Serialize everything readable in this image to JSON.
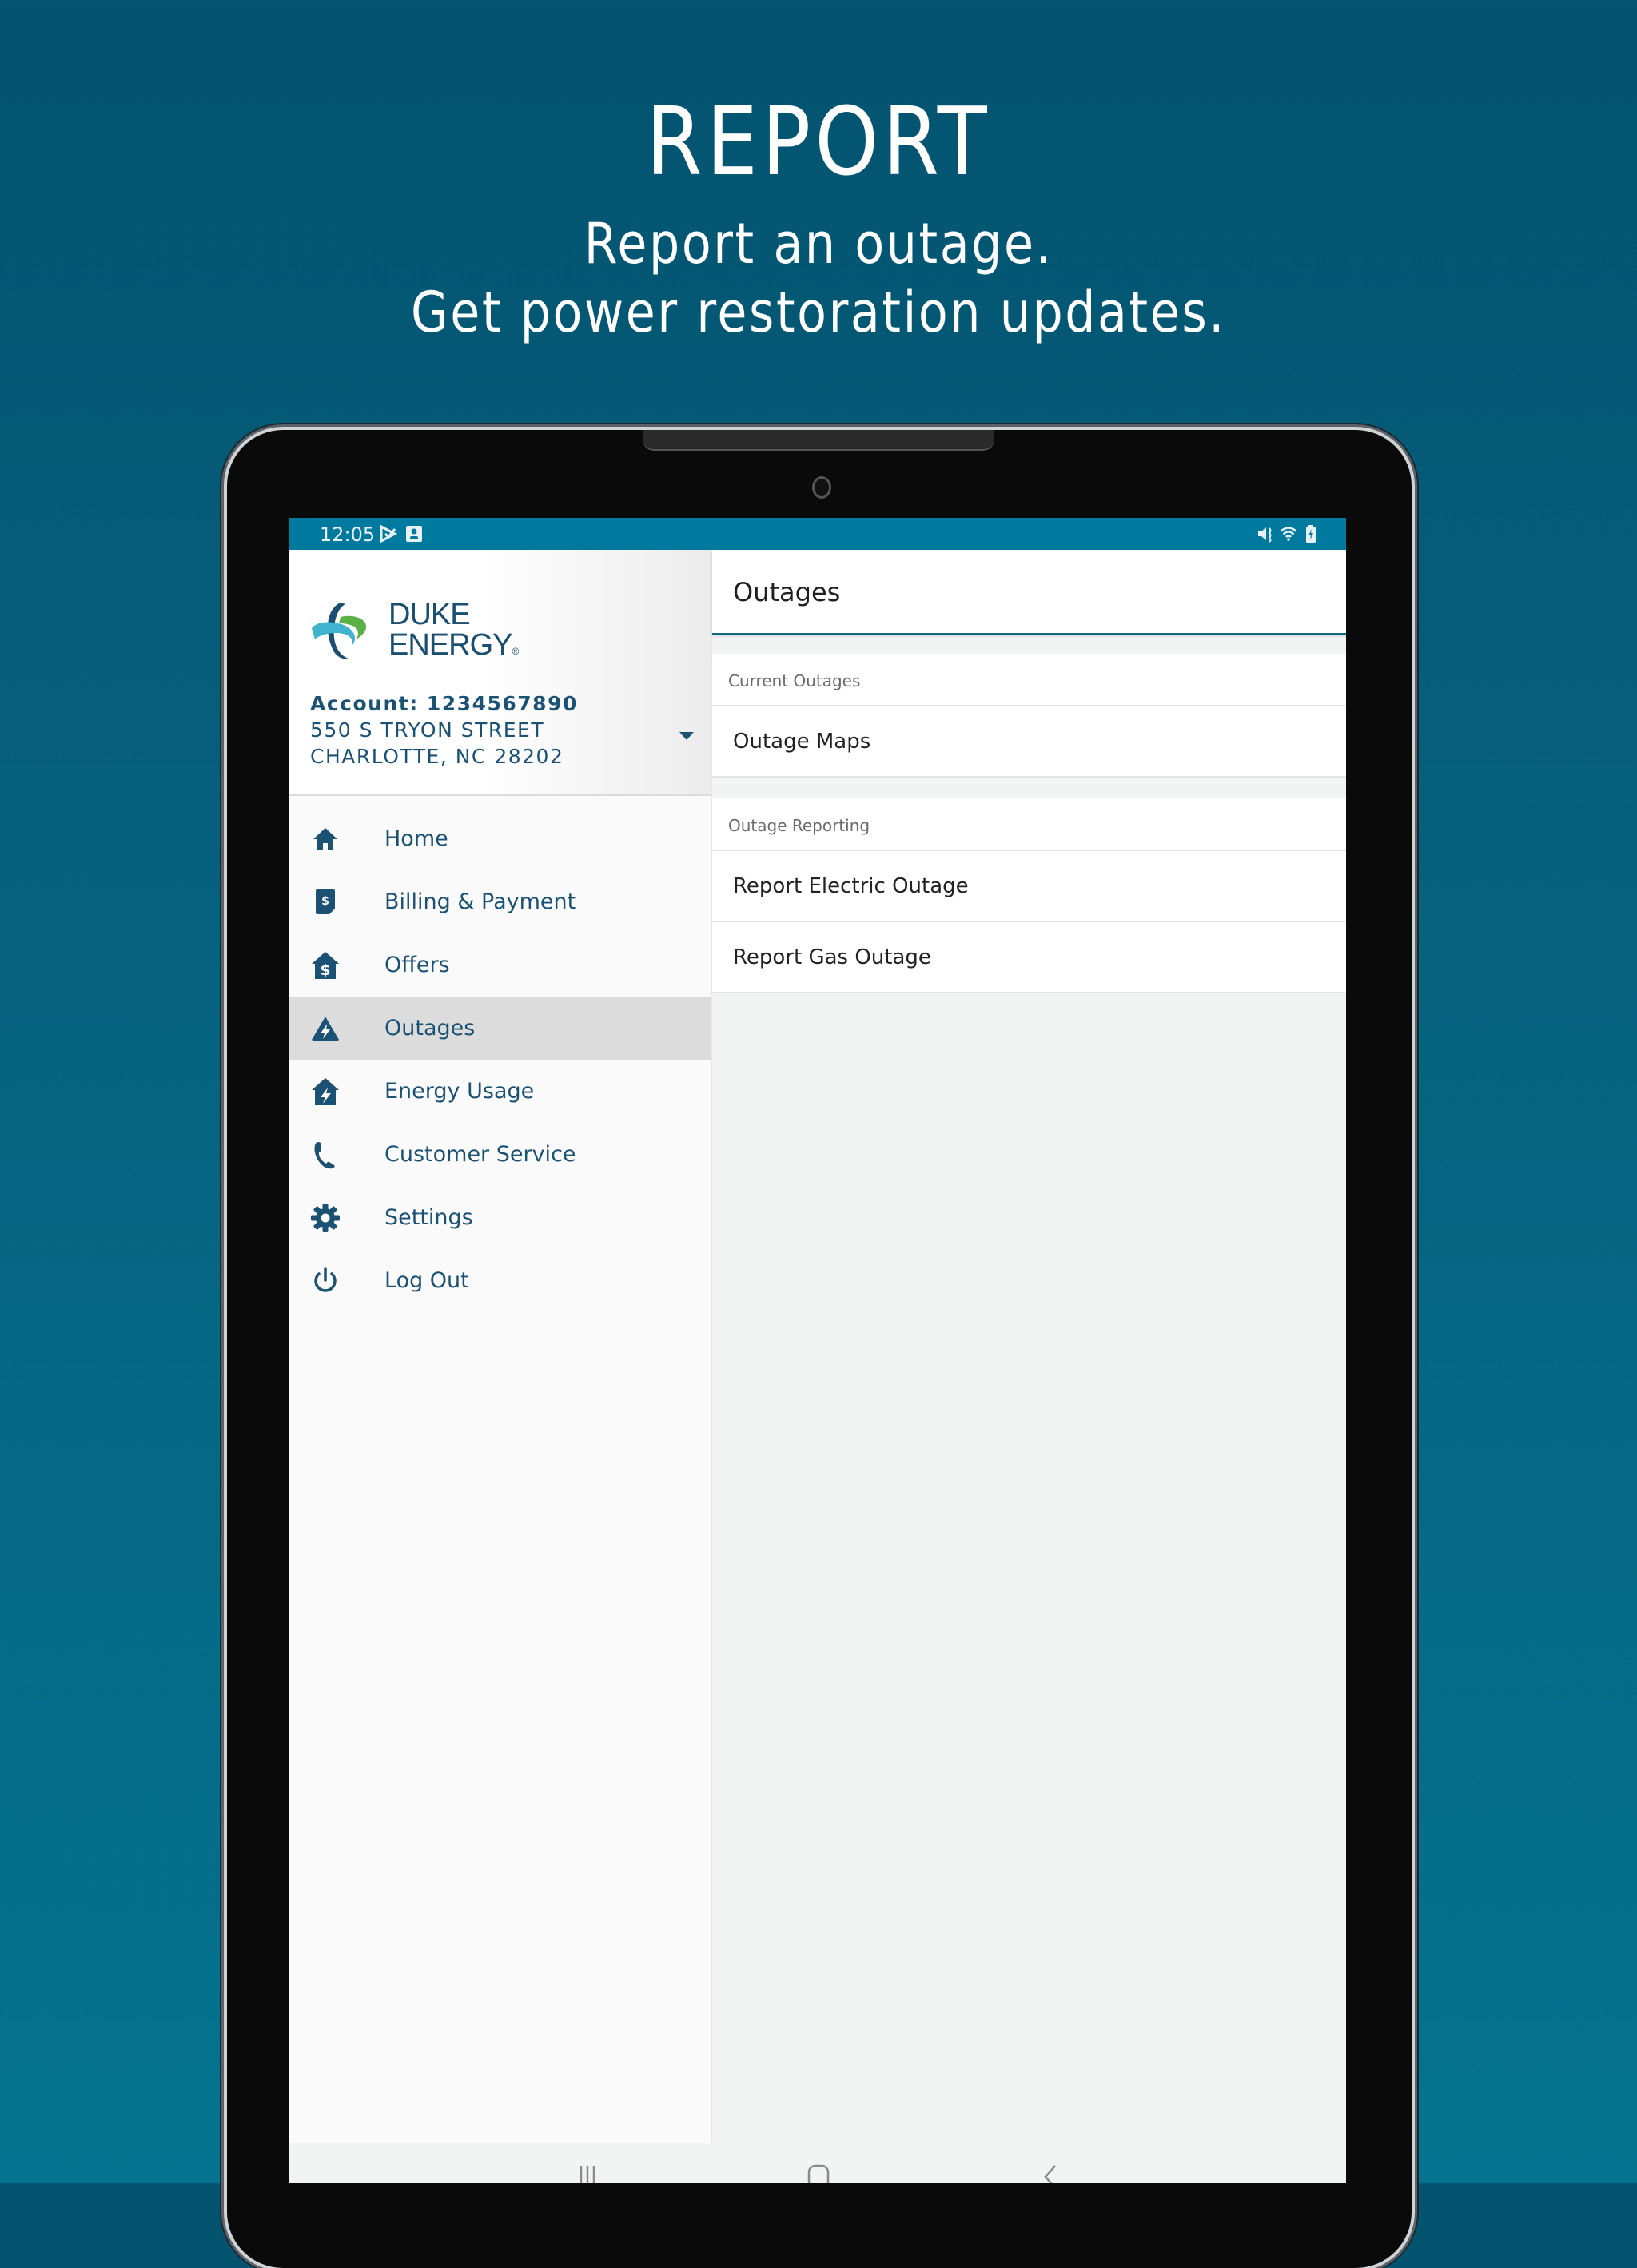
{
  "promo": {
    "title": "REPORT",
    "subtitle_line1": "Report an outage.",
    "subtitle_line2": "Get power restoration updates."
  },
  "status_bar": {
    "time": "12:05",
    "left_icons": [
      "play-store-notification-icon",
      "portrait-notification-icon"
    ],
    "right_icons": [
      "mute-icon",
      "wifi-icon",
      "battery-charging-icon"
    ]
  },
  "drawer": {
    "logo": {
      "line1": "DUKE",
      "line2": "ENERGY",
      "mark": "®"
    },
    "account": {
      "number_label": "Account: 1234567890",
      "address_line1": "550 S TRYON STREET",
      "address_line2": "CHARLOTTE, NC 28202"
    },
    "items": [
      {
        "label": "Home",
        "icon": "home-icon",
        "active": false
      },
      {
        "label": "Billing & Payment",
        "icon": "bill-icon",
        "active": false
      },
      {
        "label": "Offers",
        "icon": "house-dollar-icon",
        "active": false
      },
      {
        "label": "Outages",
        "icon": "outage-triangle-icon",
        "active": true
      },
      {
        "label": "Energy Usage",
        "icon": "house-bolt-icon",
        "active": false
      },
      {
        "label": "Customer Service",
        "icon": "phone-icon",
        "active": false
      },
      {
        "label": "Settings",
        "icon": "gear-icon",
        "active": false
      },
      {
        "label": "Log Out",
        "icon": "power-icon",
        "active": false
      }
    ]
  },
  "main": {
    "title": "Outages",
    "sections": [
      {
        "label": "Current Outages",
        "rows": [
          "Outage Maps"
        ]
      },
      {
        "label": "Outage Reporting",
        "rows": [
          "Report Electric Outage",
          "Report Gas Outage"
        ]
      }
    ]
  },
  "colors": {
    "brand_blue": "#1b5274",
    "status_bar": "#00799e",
    "header_underline": "#136585",
    "logo_green": "#5bb046",
    "logo_cyan": "#40b4cf"
  }
}
